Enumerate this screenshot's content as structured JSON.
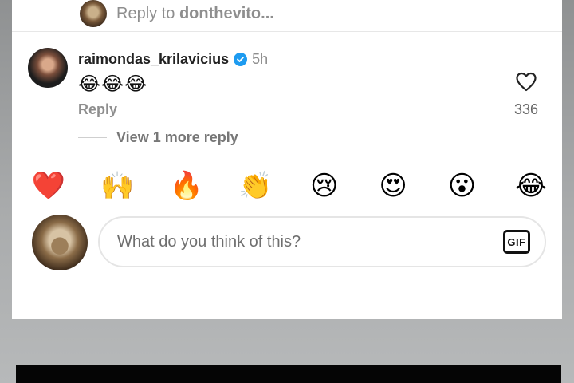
{
  "replying_bar": {
    "prefix": "Reply to",
    "username": "donthevito..."
  },
  "comment": {
    "username": "raimondas_krilavicius",
    "verified": true,
    "time": "5h",
    "text": "😂😂😂",
    "reply_label": "Reply",
    "view_replies": "View 1 more reply",
    "likes": "336"
  },
  "reactions": [
    {
      "emoji": "❤️",
      "name": "heart"
    },
    {
      "emoji": "🙌",
      "name": "raising-hands"
    },
    {
      "emoji": "🔥",
      "name": "fire"
    },
    {
      "emoji": "👏",
      "name": "clapping-hands"
    },
    {
      "emoji": "😢",
      "name": "crying-face"
    },
    {
      "emoji": "😍",
      "name": "heart-eyes"
    },
    {
      "emoji": "😮",
      "name": "surprised-face"
    },
    {
      "emoji": "😂",
      "name": "laughing-face"
    }
  ],
  "composer": {
    "placeholder": "What do you think of this?",
    "gif_label": "GIF"
  },
  "colors": {
    "verified": "#1d9bf0",
    "muted_text": "#8e8e8e",
    "border": "#e5e5e5"
  },
  "icons": {
    "like": "heart-outline-icon",
    "verified": "verified-badge-icon",
    "gif": "gif-icon"
  }
}
